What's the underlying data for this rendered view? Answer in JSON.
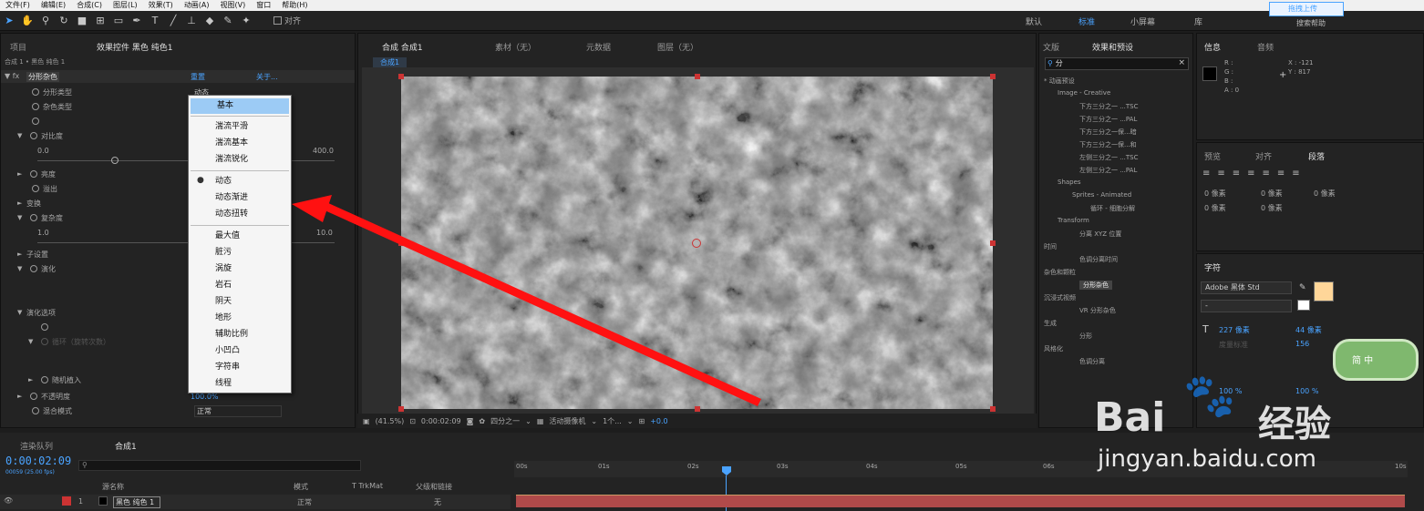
{
  "menubar": {
    "items": [
      "文件(F)",
      "编辑(E)",
      "合成(C)",
      "图层(L)",
      "效果(T)",
      "动画(A)",
      "视图(V)",
      "窗口",
      "帮助(H)"
    ]
  },
  "toolbar": {
    "align_label": "对齐",
    "workspaces": [
      "默认",
      "标准",
      "小屏幕",
      "库"
    ],
    "active_workspace": "标准",
    "upload_label": "拖拽上传",
    "search_help": "搜索帮助"
  },
  "left_panel": {
    "tabs": [
      "项目",
      "效果控件 黑色 纯色1"
    ],
    "breadcrumb": "合成 1 • 黑色 纯色 1",
    "effect_name": "分形杂色",
    "reset": "重置",
    "about": "关于...",
    "rows": [
      {
        "label": "分形类型",
        "value": "动态"
      },
      {
        "label": "杂色类型",
        "value": ""
      },
      {
        "label": "",
        "value": ""
      },
      {
        "label": "对比度",
        "value": ""
      },
      {
        "label": "0.0",
        "value": "400.0"
      },
      {
        "label": "亮度",
        "value": ""
      },
      {
        "label": "溢出",
        "value": ""
      },
      {
        "label": "变换",
        "value": ""
      },
      {
        "label": "复杂度",
        "value": ""
      },
      {
        "label": "1.0",
        "value": "10.0"
      },
      {
        "label": "子设置",
        "value": ""
      },
      {
        "label": "演化",
        "value": ""
      },
      {
        "label": "演化选项",
        "value": ""
      },
      {
        "label": "循环（旋转次数）",
        "value": ""
      },
      {
        "label": "随机植入",
        "value": ""
      },
      {
        "label": "不透明度",
        "value": "100.0%"
      },
      {
        "label": "混合模式",
        "value": "正常"
      }
    ]
  },
  "dropdown": {
    "items": [
      "基本",
      "湍流平滑",
      "湍流基本",
      "湍流锐化",
      "动态",
      "动态渐进",
      "动态扭转",
      "最大值",
      "脏污",
      "涡旋",
      "岩石",
      "阴天",
      "地形",
      "辅助比例",
      "小凹凸",
      "字符串",
      "线程"
    ],
    "selected": "基本",
    "checked": "动态"
  },
  "viewer": {
    "tabs": [
      "合成 合成1",
      "素材（无）",
      "元数据",
      "图层（无）"
    ],
    "subtab": "合成1",
    "zoom": "(41.5%)",
    "timecode": "0:00:02:09",
    "resolution": "四分之一",
    "camera": "活动摄像机",
    "views": "1个...",
    "exposure": "+0.0"
  },
  "effects_presets": {
    "tabs": [
      "文版",
      "效果和预设"
    ],
    "search": "分",
    "tree": [
      "* 动画预设",
      "Image - Creative",
      "下方三分之一 ...TSC",
      "下方三分之一 ...PAL",
      "下方三分之一保...暗",
      "下方三分之一保...和",
      "左侧三分之一 ...TSC",
      "左侧三分之一 ...PAL",
      "Shapes",
      "Sprites - Animated",
      "循环 - 细胞分解",
      "Transform",
      "分离 XYZ 位置",
      "时间",
      "色调分离时间",
      "杂色和颗粒",
      "分形杂色",
      "沉浸式视频",
      "VR 分形杂色",
      "生成",
      "分形",
      "风格化",
      "色调分离"
    ]
  },
  "info_panel": {
    "tabs": [
      "信息",
      "音频"
    ],
    "r": "R :",
    "g": "G :",
    "b": "B :",
    "a": "A : 0",
    "x": "X : -121",
    "y": "Y : 817"
  },
  "paragraph_panel": {
    "tabs": [
      "预览",
      "对齐",
      "段落"
    ],
    "px_values": [
      "0 像素",
      "0 像素",
      "0 像素",
      "0 像素",
      "0 像素"
    ]
  },
  "character_panel": {
    "title": "字符",
    "font": "Adobe 黑体 Std",
    "style": "-",
    "size": "227 像素",
    "leading": "44 像素",
    "tracking_label": "度量标准",
    "tracking": "156",
    "scale_v": "100 %",
    "scale_h": "100 %"
  },
  "timeline": {
    "tabs": [
      "渲染队列",
      "合成1"
    ],
    "timecode": "0:00:02:09",
    "fps": "00059 (25.00 fps)",
    "columns": [
      "源名称",
      "模式",
      "T TrkMat",
      "父级和链接"
    ],
    "layer": {
      "index": "1",
      "name": "黑色 纯色 1",
      "mode": "正常",
      "parent": "无"
    },
    "ticks": [
      "00s",
      "01s",
      "02s",
      "03s",
      "04s",
      "05s",
      "06s",
      "10s"
    ]
  },
  "watermark": {
    "brand": "Bai",
    "brand2": "经验",
    "url": "jingyan.baidu.com",
    "badge": "简 中"
  }
}
